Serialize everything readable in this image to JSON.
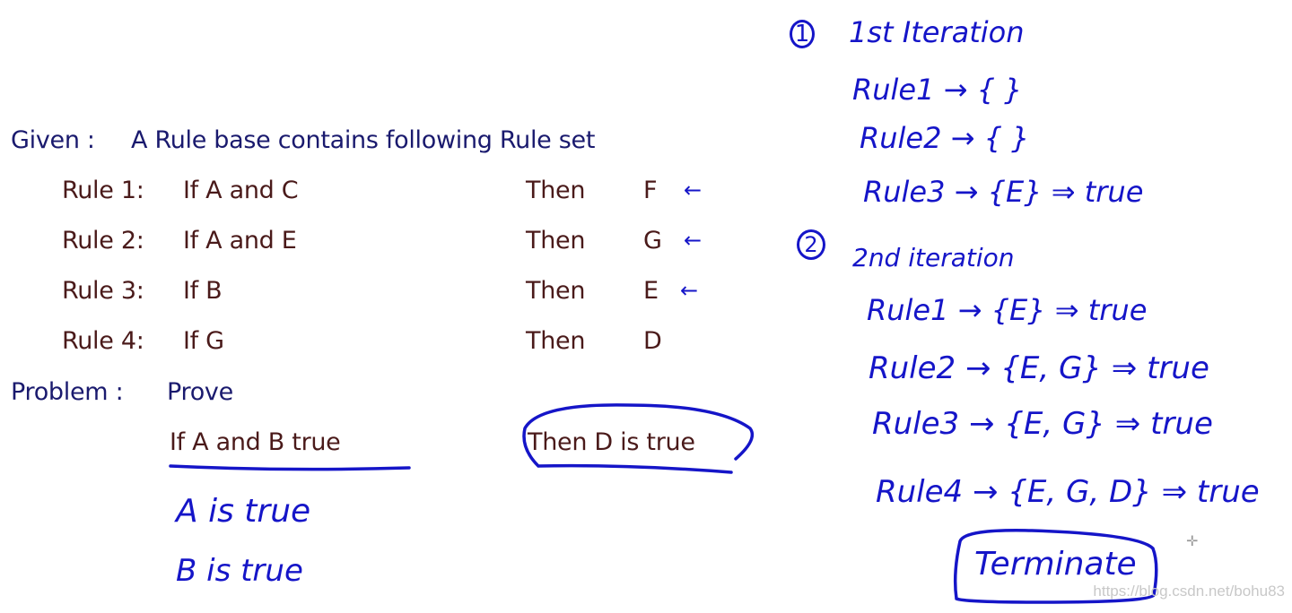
{
  "slide": {
    "given_label": "Given :",
    "given_text": "A  Rule base  contains  following  Rule set",
    "rules": [
      {
        "label": "Rule 1:",
        "condition": "If  A and  C",
        "then": "Then",
        "result": "F",
        "marked": true
      },
      {
        "label": "Rule 2:",
        "condition": "If  A and  E",
        "then": "Then",
        "result": "G",
        "marked": true
      },
      {
        "label": "Rule 3:",
        "condition": "If  B",
        "then": "Then",
        "result": "E",
        "marked": true
      },
      {
        "label": "Rule 4:",
        "condition": "If  G",
        "then": "Then",
        "result": "D",
        "marked": false
      }
    ],
    "problem_label": "Problem :",
    "problem_text": "Prove",
    "premise": "If  A and B true",
    "conclusion": "Then D is true"
  },
  "annotations": {
    "arrow_glyph": "←",
    "facts": [
      "A is true",
      "B is true"
    ],
    "iteration1": {
      "number": "1",
      "title": "1st Iteration",
      "lines": [
        "Rule1 → { }",
        "Rule2 → { }",
        "Rule3 → {E} ⇒ true"
      ]
    },
    "iteration2": {
      "number": "2",
      "title": "2nd iteration",
      "lines": [
        "Rule1 → {E} ⇒ true",
        "Rule2 → {E, G} ⇒ true",
        "Rule3 → {E, G} ⇒ true",
        "Rule4 → {E, G, D} ⇒ true"
      ]
    },
    "terminate": "Terminate"
  },
  "watermark": "https://blog.csdn.net/bohu83",
  "colors": {
    "navy_text": "#1a1a6e",
    "maroon_text": "#4a1a1a",
    "ink": "#1515c8"
  }
}
